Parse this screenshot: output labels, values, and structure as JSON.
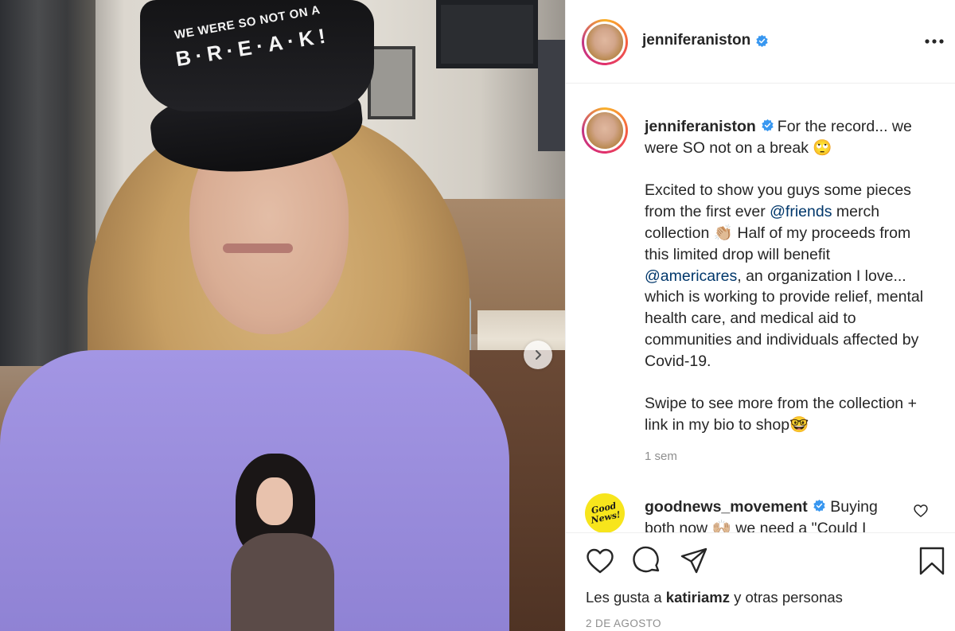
{
  "post": {
    "username": "jenniferaniston",
    "verified": true,
    "cap_line1": "WE WERE SO NOT ON A",
    "cap_line2": "B·R·E·A·K!"
  },
  "caption": {
    "username": "jenniferaniston",
    "line1": "For the record... we were SO not on a break 🙄",
    "p2_before": "Excited to show you guys some pieces from the first ever ",
    "mention_friends": "@friends",
    "p2_mid": " merch collection 👏🏼 Half of my proceeds from this limited drop will benefit ",
    "mention_americares": "@americares",
    "p2_after": ", an organization I love... which is working to provide relief, mental health care, and medical aid to communities and individuals affected by Covid-19.",
    "p3": "Swipe to see more from the collection + link in my bio to shop🤓",
    "time": "1 sem"
  },
  "comment": {
    "avatar_text": "Good News!",
    "username": "goodnews_movement",
    "text": " Buying both now 🙌🏼 we need a \"Could I"
  },
  "actions": {
    "likes_prefix": "Les gusta a ",
    "likes_user": "katiriamz",
    "likes_suffix": " y otras personas",
    "date": "2 DE AGOSTO"
  },
  "icons": {
    "verified": "verified-badge-icon",
    "more": "more-options-icon",
    "next": "chevron-right-icon",
    "like": "heart-icon",
    "comment": "comment-bubble-icon",
    "share": "paper-plane-icon",
    "save": "bookmark-icon"
  },
  "colors": {
    "verified_blue": "#3897f0",
    "mention_blue": "#00376b",
    "text": "#262626",
    "muted": "#8e8e8e",
    "comment_avatar": "#f7e51c"
  }
}
